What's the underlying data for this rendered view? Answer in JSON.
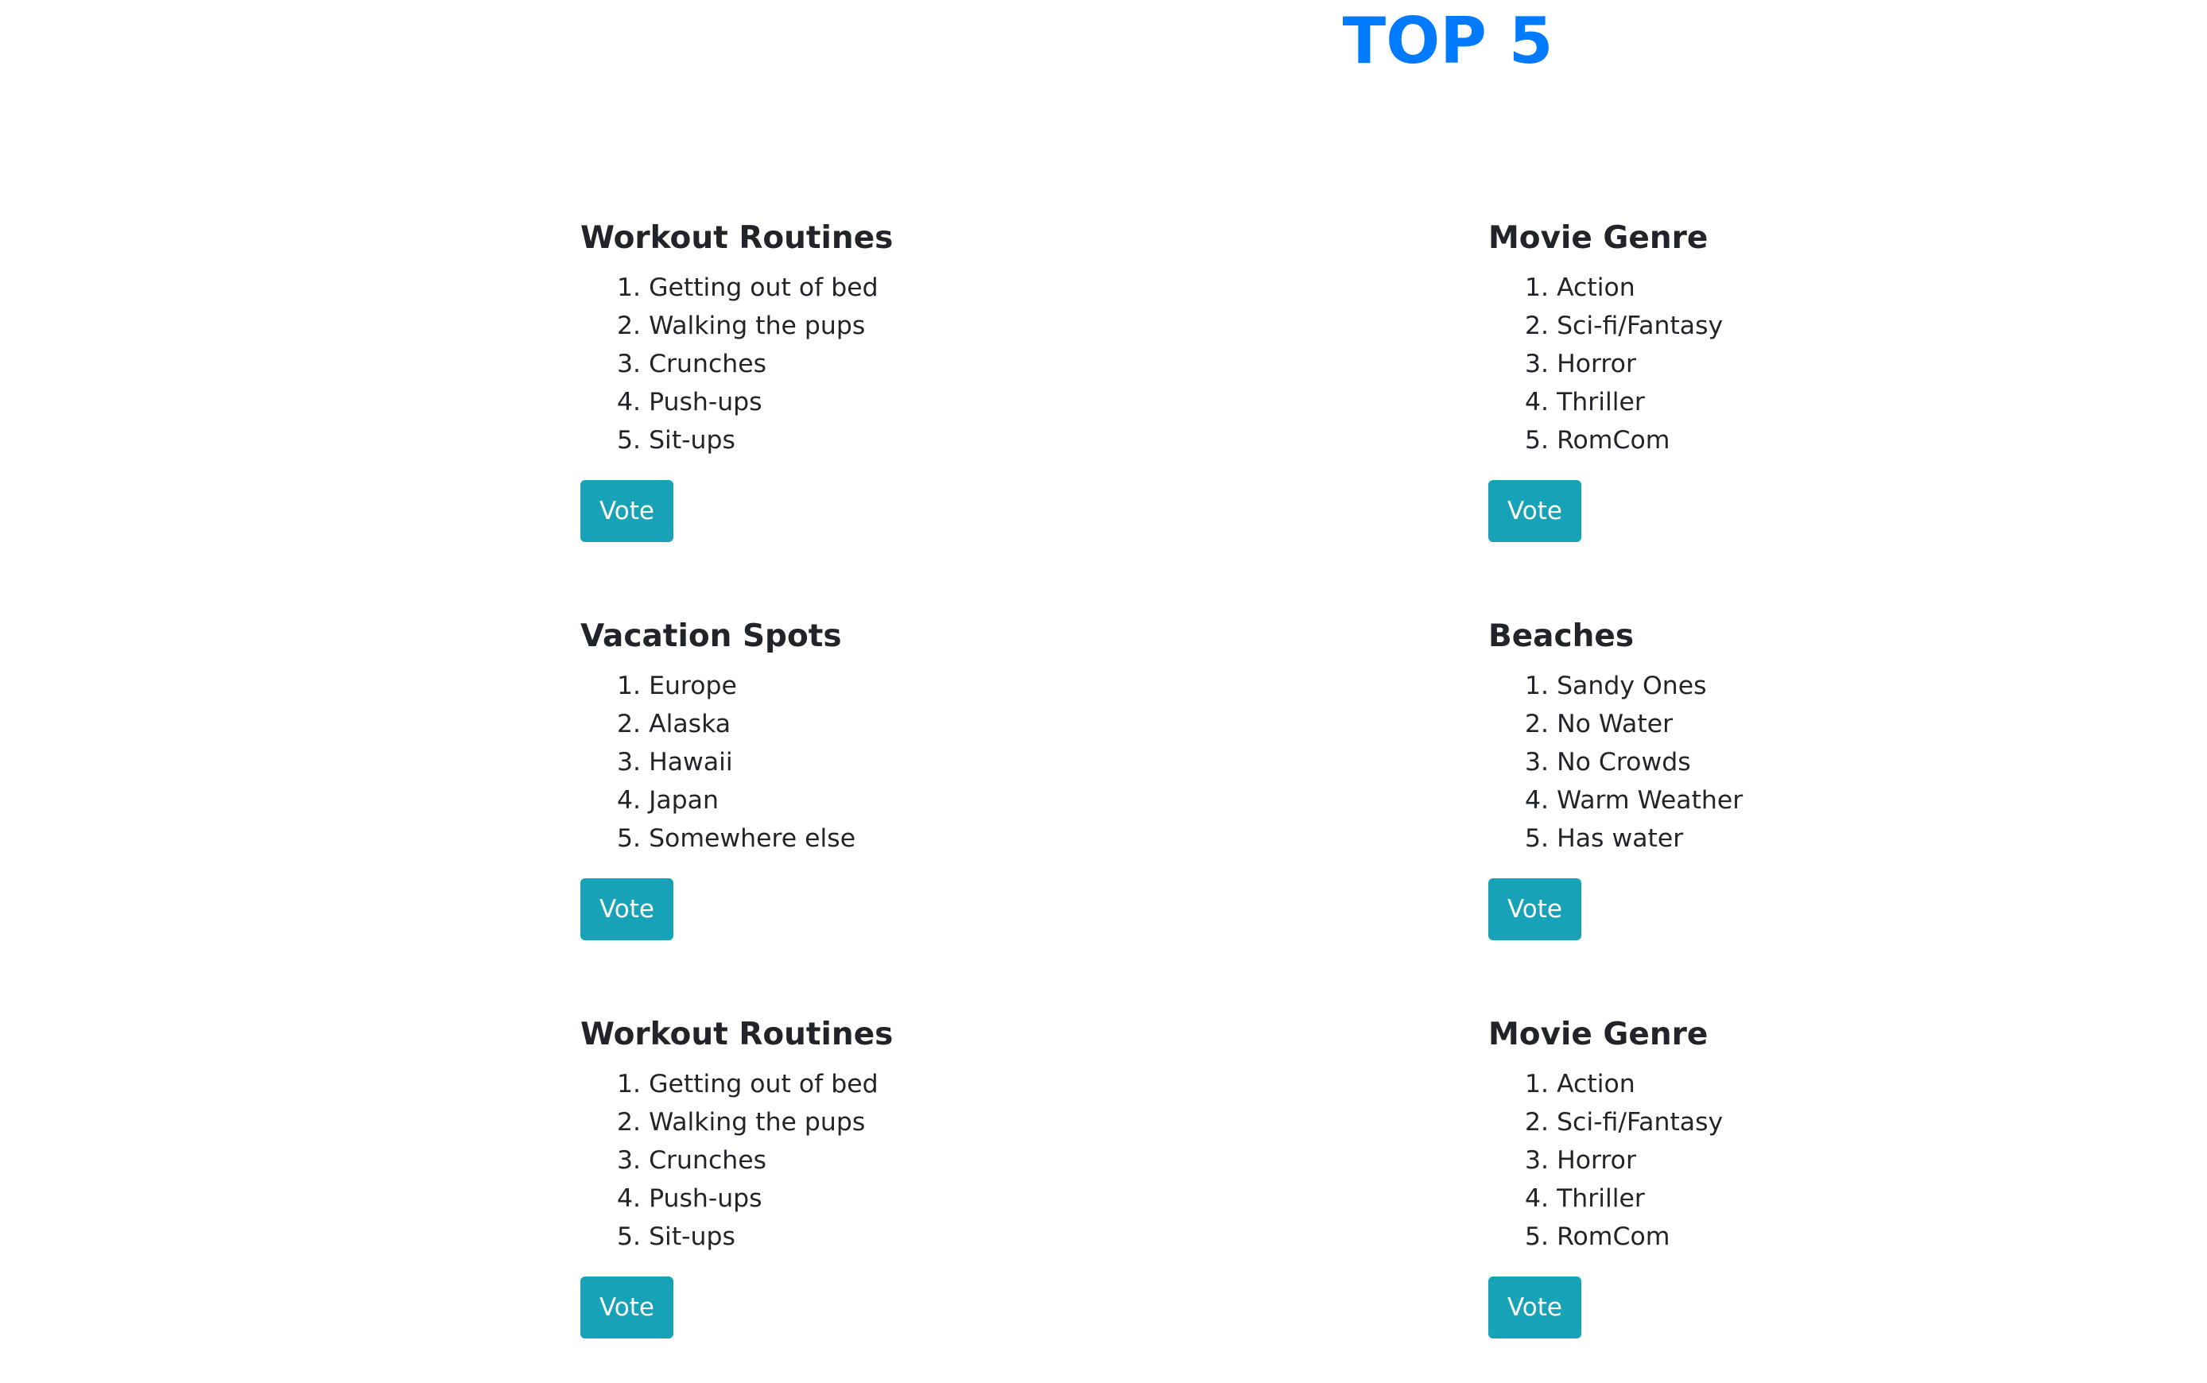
{
  "header": {
    "title": "TOP 5"
  },
  "cards": [
    {
      "title": "Workout Routines",
      "items": [
        "1. Getting out of bed",
        "2. Walking the pups",
        "3. Crunches",
        "4. Push-ups",
        "5. Sit-ups"
      ],
      "button": "Vote"
    },
    {
      "title": "Movie Genre",
      "items": [
        "1. Action",
        "2. Sci-fi/Fantasy",
        "3. Horror",
        "4. Thriller",
        "5. RomCom"
      ],
      "button": "Vote"
    },
    {
      "title": "Vacation Spots",
      "items": [
        "1. Europe",
        "2. Alaska",
        "3. Hawaii",
        "4. Japan",
        "5. Somewhere else"
      ],
      "button": "Vote"
    },
    {
      "title": "Beaches",
      "items": [
        "1. Sandy Ones",
        "2. No Water",
        "3. No Crowds",
        "4. Warm Weather",
        "5. Has water"
      ],
      "button": "Vote"
    },
    {
      "title": "Workout Routines",
      "items": [
        "1. Getting out of bed",
        "2. Walking the pups",
        "3. Crunches",
        "4. Push-ups",
        "5. Sit-ups"
      ],
      "button": "Vote"
    },
    {
      "title": "Movie Genre",
      "items": [
        "1. Action",
        "2. Sci-fi/Fantasy",
        "3. Horror",
        "4. Thriller",
        "5. RomCom"
      ],
      "button": "Vote"
    }
  ],
  "colors": {
    "title": "#007bff",
    "button": "#17a2b8",
    "text": "#212529"
  }
}
